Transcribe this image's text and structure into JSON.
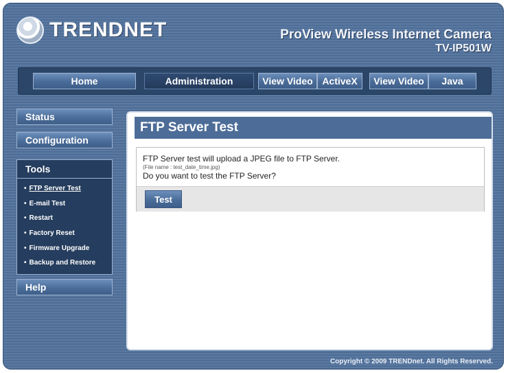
{
  "brand": {
    "logo_text": "TRENDNET"
  },
  "product": {
    "name": "ProView Wireless Internet Camera",
    "model": "TV-IP501W"
  },
  "nav": {
    "home": "Home",
    "administration": "Administration",
    "view_video_activex": "View Video",
    "activex": "ActiveX",
    "view_video_java": "View Video",
    "java": "Java"
  },
  "sidebar": {
    "status": "Status",
    "configuration": "Configuration",
    "tools": {
      "label": "Tools",
      "items": [
        {
          "label": "FTP Server Test"
        },
        {
          "label": "E-mail Test"
        },
        {
          "label": "Restart"
        },
        {
          "label": "Factory Reset"
        },
        {
          "label": "Firmware Upgrade"
        },
        {
          "label": "Backup and Restore"
        }
      ]
    },
    "help": "Help",
    "bullet": "•"
  },
  "main": {
    "title": "FTP Server Test",
    "line1": "FTP Server test will upload a JPEG file to FTP Server.",
    "line2": "(File name : test_date_time.jpg)",
    "line3": "Do you want to test the FTP Server?",
    "test_button": "Test"
  },
  "footer": {
    "copyright": "Copyright © 2009 TRENDnet. All Rights Reserved."
  },
  "colors": {
    "background": "#5a7aa2",
    "panel_title": "#4d6d98",
    "nav_bar": "#2c4669"
  }
}
